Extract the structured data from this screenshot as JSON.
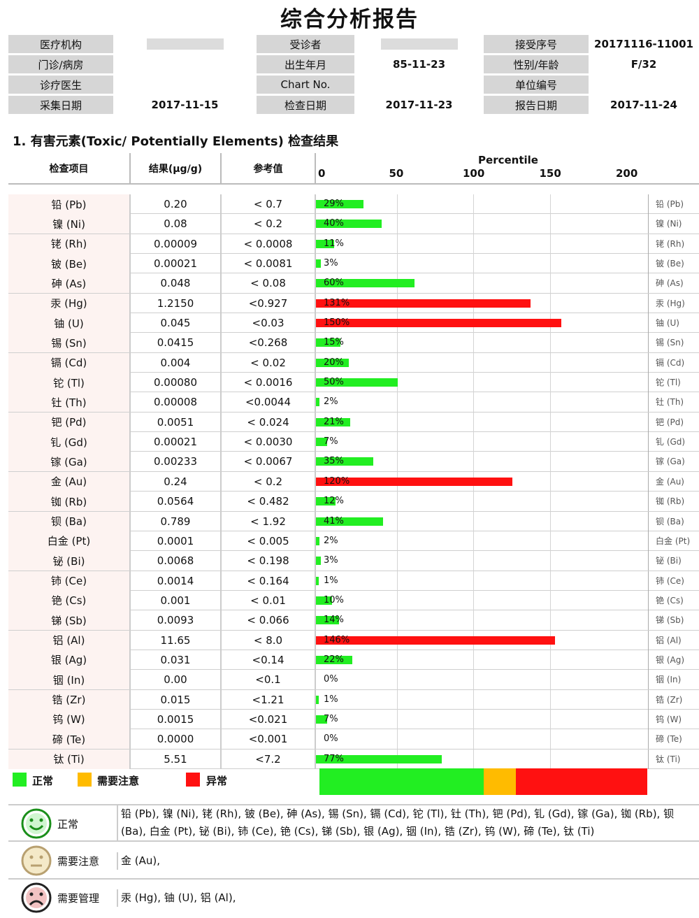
{
  "title": "综合分析报告",
  "info": {
    "rows": [
      [
        {
          "label": "医疗机构",
          "value": "",
          "redacted": true
        },
        {
          "label": "受诊者",
          "value": "",
          "redacted": true
        },
        {
          "label": "接受序号",
          "value": "20171116-11001"
        }
      ],
      [
        {
          "label": "门诊/病房",
          "value": ""
        },
        {
          "label": "出生年月",
          "value": "85-11-23"
        },
        {
          "label": "性别/年龄",
          "value": "F/32"
        }
      ],
      [
        {
          "label": "诊疗医生",
          "value": ""
        },
        {
          "label": "Chart No.",
          "value": ""
        },
        {
          "label": "单位编号",
          "value": ""
        }
      ],
      [
        {
          "label": "采集日期",
          "value": "2017-11-15"
        },
        {
          "label": "检查日期",
          "value": "2017-11-23"
        },
        {
          "label": "报告日期",
          "value": "2017-11-24"
        }
      ]
    ]
  },
  "section_title": "1. 有害元素(Toxic/ Potentially Elements) 检查结果",
  "table": {
    "headers": {
      "item": "检查项目",
      "result": "结果(μg/g)",
      "reference": "参考值"
    },
    "percentile_title": "Percentile",
    "ticks": [
      "0",
      "50",
      "100",
      "150",
      "200"
    ]
  },
  "colors": {
    "normal": "#22ee22",
    "attention": "#ffbb00",
    "abnormal": "#ff1111"
  },
  "chart_data": {
    "type": "bar",
    "title": "Percentile",
    "xlim": [
      0,
      200
    ],
    "categories": [
      "铅 (Pb)",
      "镍 (Ni)",
      "铑 (Rh)",
      "铍 (Be)",
      "砷 (As)",
      "汞 (Hg)",
      "铀 (U)",
      "锡 (Sn)",
      "镉 (Cd)",
      "铊 (Tl)",
      "钍 (Th)",
      "钯 (Pd)",
      "钆 (Gd)",
      "镓 (Ga)",
      "金 (Au)",
      "铷 (Rb)",
      "钡 (Ba)",
      "白金 (Pt)",
      "铋 (Bi)",
      "铈 (Ce)",
      "铯 (Cs)",
      "锑 (Sb)",
      "铝 (Al)",
      "银 (Ag)",
      "铟 (In)",
      "锆 (Zr)",
      "钨 (W)",
      "碲 (Te)",
      "钛 (Ti)"
    ],
    "results": [
      "0.20",
      "0.08",
      "0.00009",
      "0.00021",
      "0.048",
      "1.2150",
      "0.045",
      "0.0415",
      "0.004",
      "0.00080",
      "0.00008",
      "0.0051",
      "0.00021",
      "0.00233",
      "0.24",
      "0.0564",
      "0.789",
      "0.0001",
      "0.0068",
      "0.0014",
      "0.001",
      "0.0093",
      "11.65",
      "0.031",
      "0.00",
      "0.015",
      "0.0015",
      "0.0000",
      "5.51"
    ],
    "references": [
      "< 0.7",
      "< 0.2",
      "< 0.0008",
      "< 0.0081",
      "< 0.08",
      "<0.927",
      "<0.03",
      "<0.268",
      "< 0.02",
      "< 0.0016",
      "<0.0044",
      "< 0.024",
      "< 0.0030",
      "< 0.0067",
      "< 0.2",
      "< 0.482",
      "< 1.92",
      "< 0.005",
      "< 0.198",
      "< 0.164",
      "< 0.01",
      "< 0.066",
      "< 8.0",
      "<0.14",
      "<0.1",
      "<1.21",
      "<0.021",
      "<0.001",
      "<7.2"
    ],
    "values": [
      29,
      40,
      11,
      3,
      60,
      131,
      150,
      15,
      20,
      50,
      2,
      21,
      7,
      35,
      120,
      12,
      41,
      2,
      3,
      1,
      10,
      14,
      146,
      22,
      0,
      1,
      7,
      0,
      77
    ],
    "status": [
      "normal",
      "normal",
      "normal",
      "normal",
      "normal",
      "abnormal",
      "abnormal",
      "normal",
      "normal",
      "normal",
      "normal",
      "normal",
      "normal",
      "normal",
      "abnormal",
      "normal",
      "normal",
      "normal",
      "normal",
      "normal",
      "normal",
      "normal",
      "abnormal",
      "normal",
      "normal",
      "normal",
      "normal",
      "normal",
      "normal"
    ],
    "side_labels": [
      "铅 (Pb)",
      "镍 (Ni)",
      "铑 (Rh)",
      "铍 (Be)",
      "砷 (As)",
      "汞 (Hg)",
      "铀 (U)",
      "锡 (Sn)",
      "镉 (Cd)",
      "铊 (Tl)",
      "钍 (Th)",
      "钯 (Pd)",
      "钆 (Gd)",
      "镓 (Ga)",
      "金 (Au)",
      "铷 (Rb)",
      "钡 (Ba)",
      "白金 (Pt)",
      "铋 (Bi)",
      "铈 (Ce)",
      "铯 (Cs)",
      "锑 (Sb)",
      "铝 (Al)",
      "银 (Ag)",
      "铟 (In)",
      "锆 (Zr)",
      "钨 (W)",
      "碲 (Te)",
      "钛 (Ti)"
    ]
  },
  "legend": {
    "normal": "正常",
    "attention": "需要注意",
    "abnormal": "异常"
  },
  "scale_bar": {
    "normal_fraction": 0.5,
    "attention_fraction": 0.1,
    "abnormal_fraction": 0.4
  },
  "summary": [
    {
      "label": "正常",
      "face": "smile-face-icon",
      "text": "铅 (Pb), 镍 (Ni), 铑 (Rh), 铍 (Be), 砷 (As), 锡 (Sn), 镉 (Cd), 铊 (Tl), 钍 (Th), 钯 (Pd), 钆 (Gd), 镓 (Ga), 铷 (Rb), 钡 (Ba), 白金 (Pt), 铋 (Bi), 铈 (Ce), 铯 (Cs), 锑 (Sb), 银 (Ag), 铟 (In), 锆 (Zr), 钨 (W), 碲 (Te), 钛 (Ti)"
    },
    {
      "label": "需要注意",
      "face": "neutral-face-icon",
      "text": "金 (Au),"
    },
    {
      "label": "需要管理",
      "face": "sad-face-icon",
      "text": "汞 (Hg), 铀 (U), 铝 (Al),"
    }
  ]
}
